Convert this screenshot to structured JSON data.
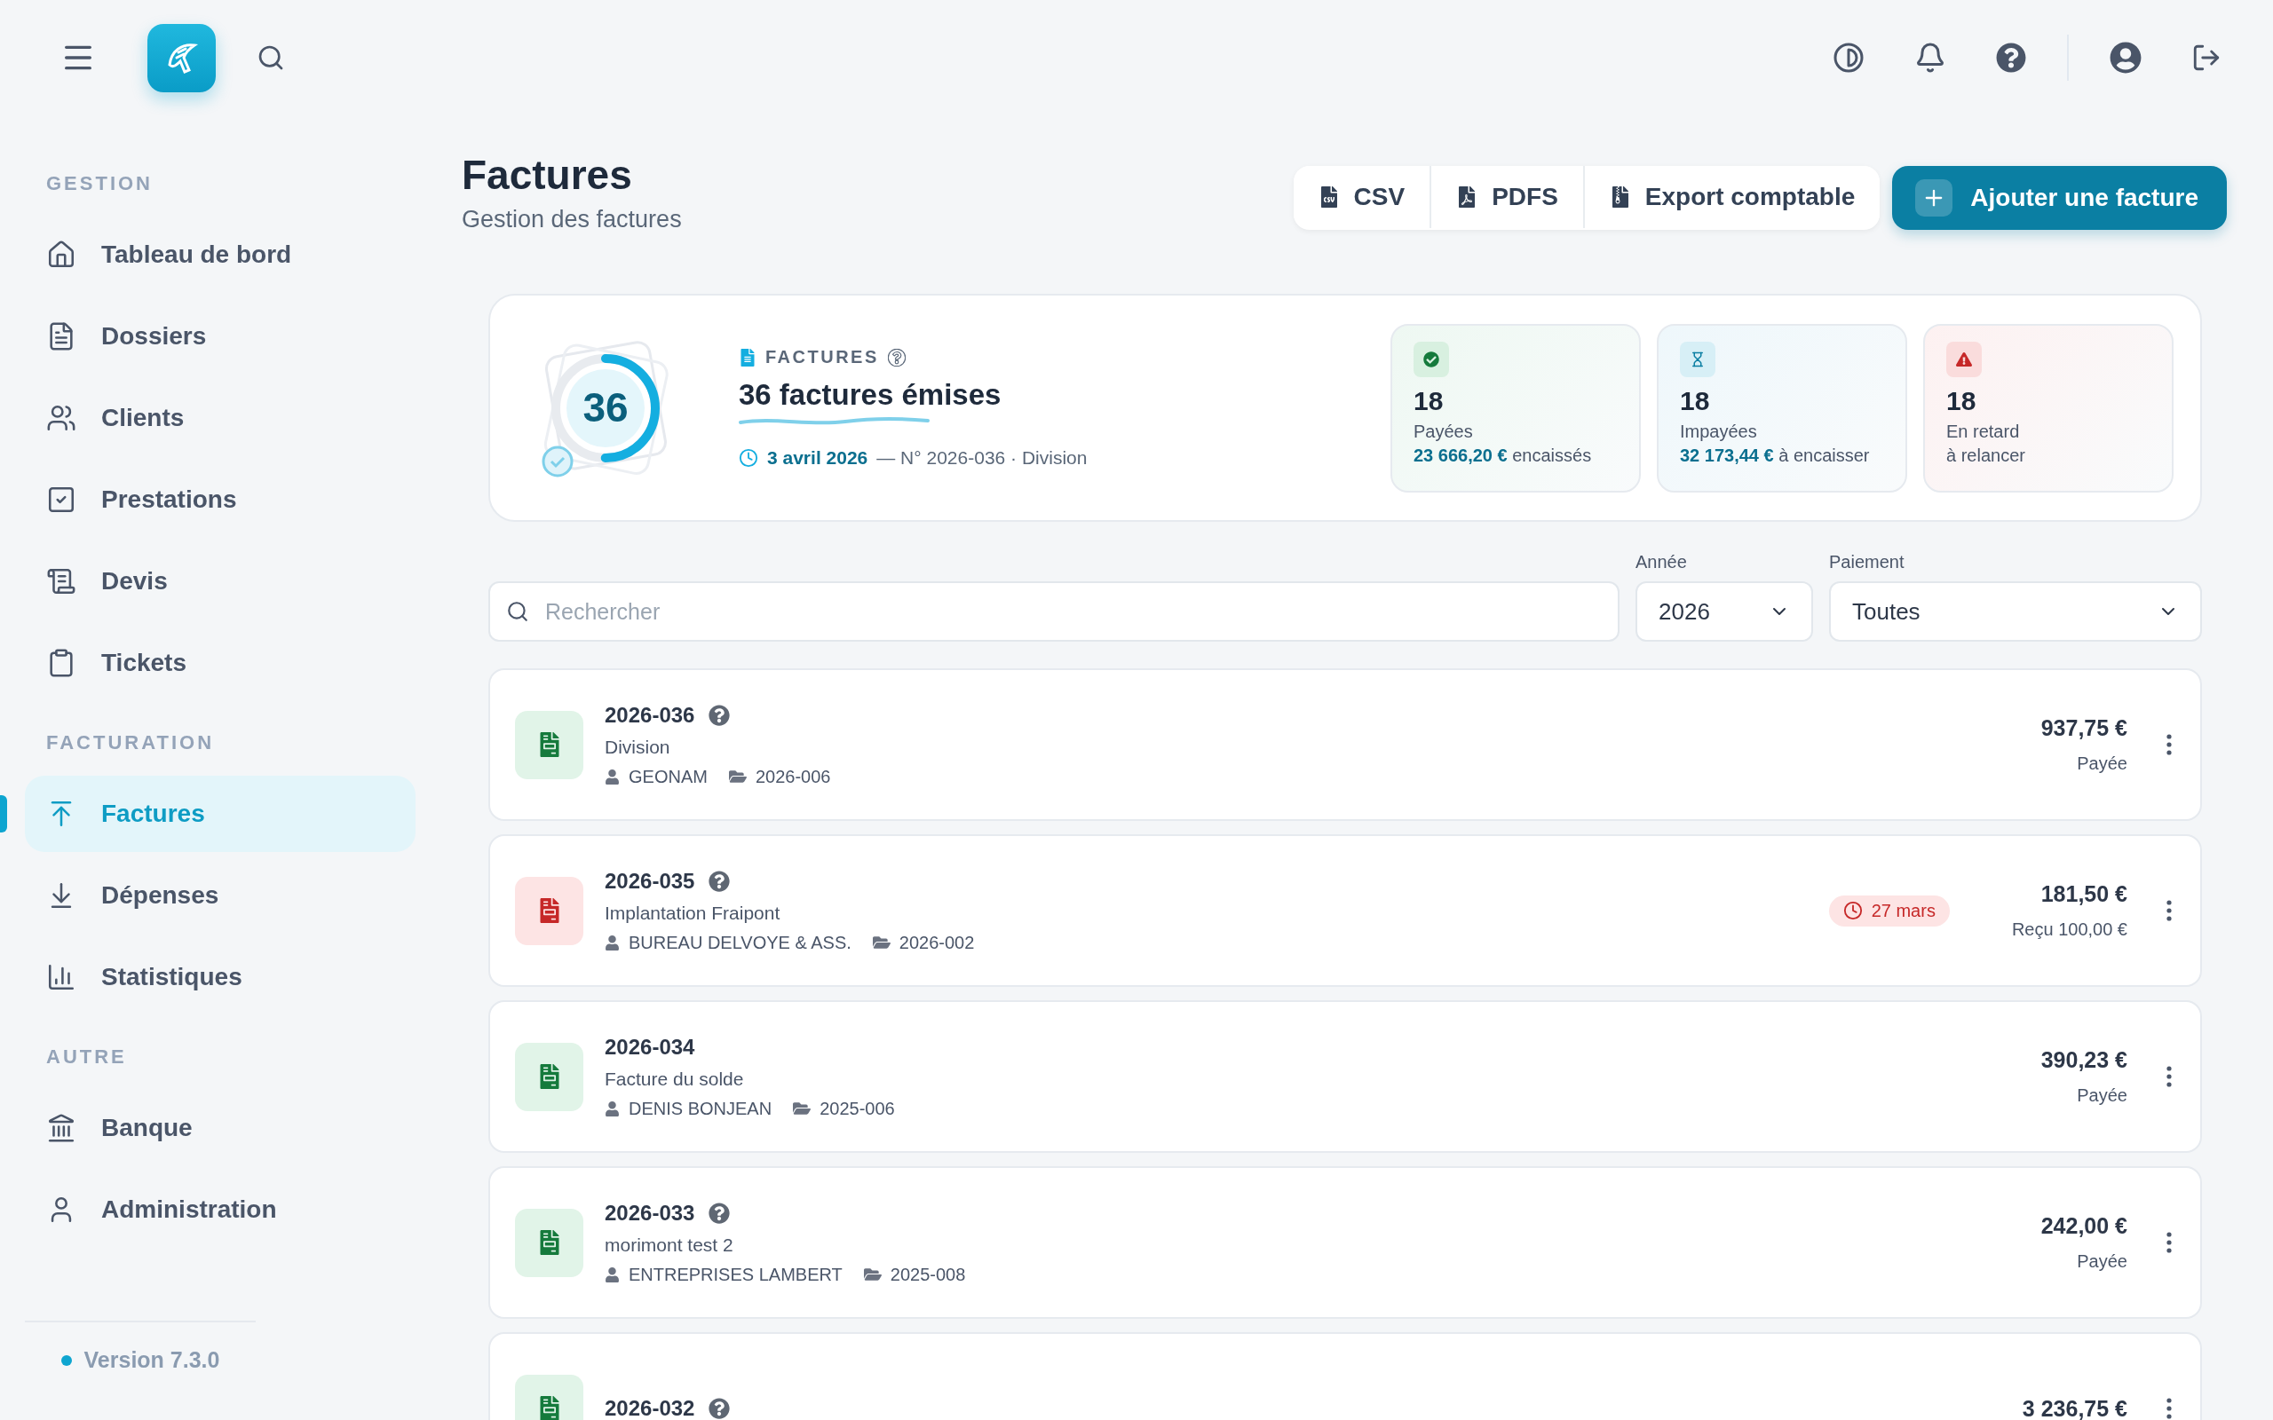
{
  "sidebar": {
    "sections": [
      {
        "title": "GESTION",
        "items": [
          {
            "label": "Tableau de bord",
            "selected": false
          },
          {
            "label": "Dossiers",
            "selected": false
          },
          {
            "label": "Clients",
            "selected": false
          },
          {
            "label": "Prestations",
            "selected": false
          },
          {
            "label": "Devis",
            "selected": false
          },
          {
            "label": "Tickets",
            "selected": false
          }
        ]
      },
      {
        "title": "FACTURATION",
        "items": [
          {
            "label": "Factures",
            "selected": true
          },
          {
            "label": "Dépenses",
            "selected": false
          },
          {
            "label": "Statistiques",
            "selected": false
          }
        ]
      },
      {
        "title": "AUTRE",
        "items": [
          {
            "label": "Banque",
            "selected": false
          },
          {
            "label": "Administration",
            "selected": false
          }
        ]
      }
    ],
    "version": "Version 7.3.0"
  },
  "header": {
    "title": "Factures",
    "subtitle": "Gestion des factures",
    "exports": [
      "CSV",
      "PDFS",
      "Export comptable"
    ],
    "primary": "Ajouter une facture"
  },
  "summary": {
    "count": "36",
    "level": 0.5,
    "label": "FACTURES",
    "title": "36 factures émises",
    "date": "3 avril 2026",
    "detail": "— N° 2026-036 · Division",
    "stats": [
      {
        "kind": "paid",
        "value": "18",
        "label": "Payées",
        "amount": "23 666,20 €",
        "note": "encaissés"
      },
      {
        "kind": "unpaid",
        "value": "18",
        "label": "Impayées",
        "amount": "32 173,44 €",
        "note": "à encaisser"
      },
      {
        "kind": "late",
        "value": "18",
        "label": "En retard",
        "note": "à relancer"
      }
    ]
  },
  "filters": {
    "search": {
      "placeholder": "Rechercher"
    },
    "year": {
      "label": "Année",
      "value": "2026"
    },
    "payment": {
      "label": "Paiement",
      "value": "Toutes"
    }
  },
  "invoices": [
    {
      "kind": "paid",
      "number": "2026-036",
      "help": true,
      "description": "Division",
      "client": "GEONAM",
      "folder": "2026-006",
      "amount": "937,75 €",
      "status": "Payée"
    },
    {
      "kind": "late",
      "number": "2026-035",
      "help": true,
      "description": "Implantation Fraipont",
      "client": "BUREAU DELVOYE & ASS.",
      "folder": "2026-002",
      "overdue": "27 mars",
      "amount": "181,50 €",
      "status": "Reçu 100,00 €"
    },
    {
      "kind": "paid",
      "number": "2026-034",
      "help": false,
      "description": "Facture du solde",
      "client": "DENIS BONJEAN",
      "folder": "2025-006",
      "amount": "390,23 €",
      "status": "Payée"
    },
    {
      "kind": "paid",
      "number": "2026-033",
      "help": true,
      "description": "morimont test 2",
      "client": "ENTREPRISES LAMBERT",
      "folder": "2025-008",
      "amount": "242,00 €",
      "status": "Payée"
    },
    {
      "kind": "paid",
      "number": "2026-032",
      "help": true,
      "amount": "3 236,75 €"
    }
  ]
}
